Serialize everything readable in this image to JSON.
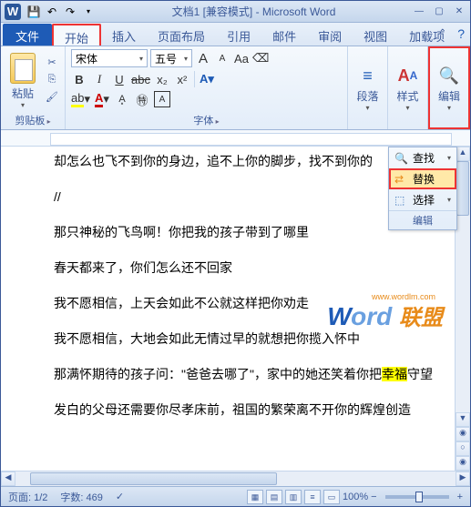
{
  "title": "文档1 [兼容模式] - Microsoft Word",
  "app_letter": "W",
  "tabs": {
    "file": "文件",
    "home": "开始",
    "insert": "插入",
    "layout": "页面布局",
    "references": "引用",
    "mail": "邮件",
    "review": "审阅",
    "view": "视图",
    "addins": "加载项"
  },
  "clipboard": {
    "paste": "粘贴",
    "label": "剪贴板"
  },
  "font": {
    "name": "宋体",
    "size": "五号",
    "label": "字体",
    "bold": "B",
    "italic": "I",
    "underline": "U",
    "strike": "abc",
    "sub": "x₂",
    "sup": "x²",
    "grow": "A",
    "shrink": "A",
    "aa": "Aa"
  },
  "paragraph": {
    "label": "段落"
  },
  "styles": {
    "label": "样式",
    "letter": "A"
  },
  "editing": {
    "label": "编辑"
  },
  "edit_menu": {
    "find": "查找",
    "replace": "替换",
    "select": "选择",
    "footer": "编辑"
  },
  "document": {
    "lines": [
      "却怎么也飞不到你的身边，追不上你的脚步，找不到你的",
      "//",
      "那只神秘的飞鸟啊！你把我的孩子带到了哪里",
      "春天都来了，你们怎么还不回家",
      "我不愿相信，上天会如此不公就这样把你劝走",
      "我不愿相信，大地会如此无情过早的就想把你揽入怀中",
      "那满怀期待的孩子问：\"爸爸去哪了\"，家中的她还笑着你把幸福守望",
      "发白的父母还需要你尽孝床前，祖国的繁荣离不开你的辉煌创造"
    ]
  },
  "watermark": {
    "w": "W",
    "ord": "ord",
    "lm": "联盟",
    "url": "www.wordlm.com"
  },
  "status": {
    "page": "页面: 1/2",
    "words": "字数: 469",
    "lang_icon": "✓",
    "zoom": "100%",
    "minus": "−",
    "plus": "+"
  }
}
